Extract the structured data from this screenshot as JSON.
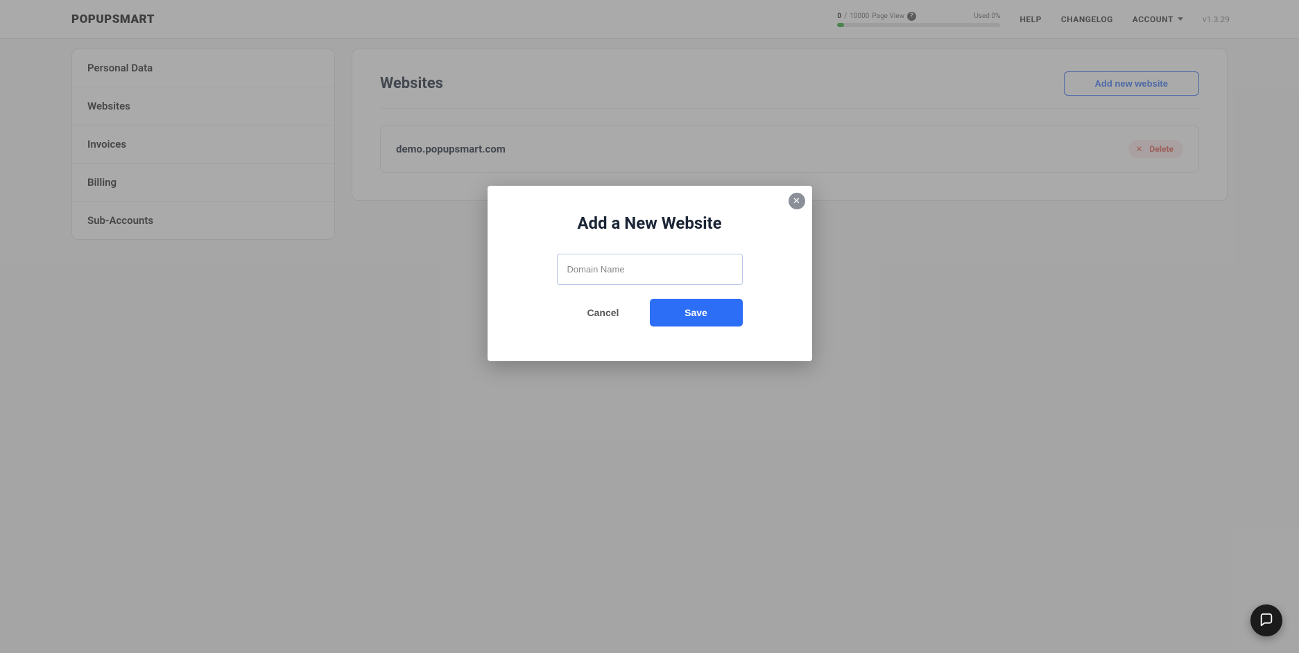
{
  "header": {
    "logo": "POPUPSMART",
    "usage": {
      "current": "0",
      "sep": "/",
      "limit": "10000",
      "label": "Page View",
      "used_label": "Used 0%"
    },
    "nav": {
      "help": "HELP",
      "changelog": "CHANGELOG",
      "account": "ACCOUNT",
      "version": "v1.3.29"
    }
  },
  "sidebar": {
    "items": [
      {
        "label": "Personal Data"
      },
      {
        "label": "Websites"
      },
      {
        "label": "Invoices"
      },
      {
        "label": "Billing"
      },
      {
        "label": "Sub-Accounts"
      }
    ]
  },
  "content": {
    "title": "Websites",
    "add_button": "Add new website",
    "sites": [
      {
        "name": "demo.popupsmart.com",
        "delete_label": "Delete"
      }
    ]
  },
  "modal": {
    "title": "Add a New Website",
    "placeholder": "Domain Name",
    "cancel": "Cancel",
    "save": "Save"
  }
}
